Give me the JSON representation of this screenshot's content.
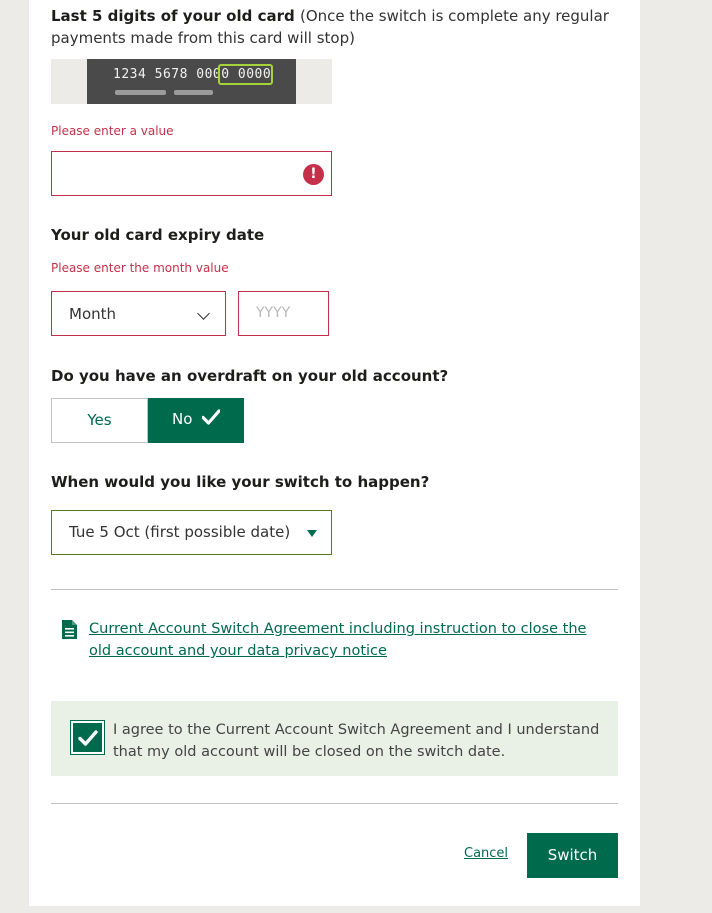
{
  "card_digits": {
    "label": "Last 5 digits of your old card",
    "note": "(Once the switch is complete any regular payments made from this card will stop)",
    "card_illustration_number": "1234 5678 0000 0000",
    "error": "Please enter a value",
    "value": ""
  },
  "expiry": {
    "label": "Your old card expiry date",
    "error": "Please enter the month value",
    "month_selected": "Month",
    "year_placeholder": "YYYY"
  },
  "overdraft": {
    "label": "Do you have an overdraft on your old account?",
    "yes_label": "Yes",
    "no_label": "No",
    "selected": "No"
  },
  "switch_date": {
    "label": "When would you like your switch to happen?",
    "selected": "Tue 5 Oct (first possible date)"
  },
  "agreement": {
    "link_text": "Current Account Switch Agreement including instruction to close the old account and your data privacy notice",
    "checkbox_text": "I agree to the Current Account Switch Agreement and I understand that my old account will be closed on the switch date.",
    "checked": true
  },
  "actions": {
    "cancel_label": "Cancel",
    "switch_label": "Switch"
  },
  "colors": {
    "brand_green": "#006a4d",
    "error_red": "#c4304a",
    "page_bg": "#ecebe7"
  }
}
